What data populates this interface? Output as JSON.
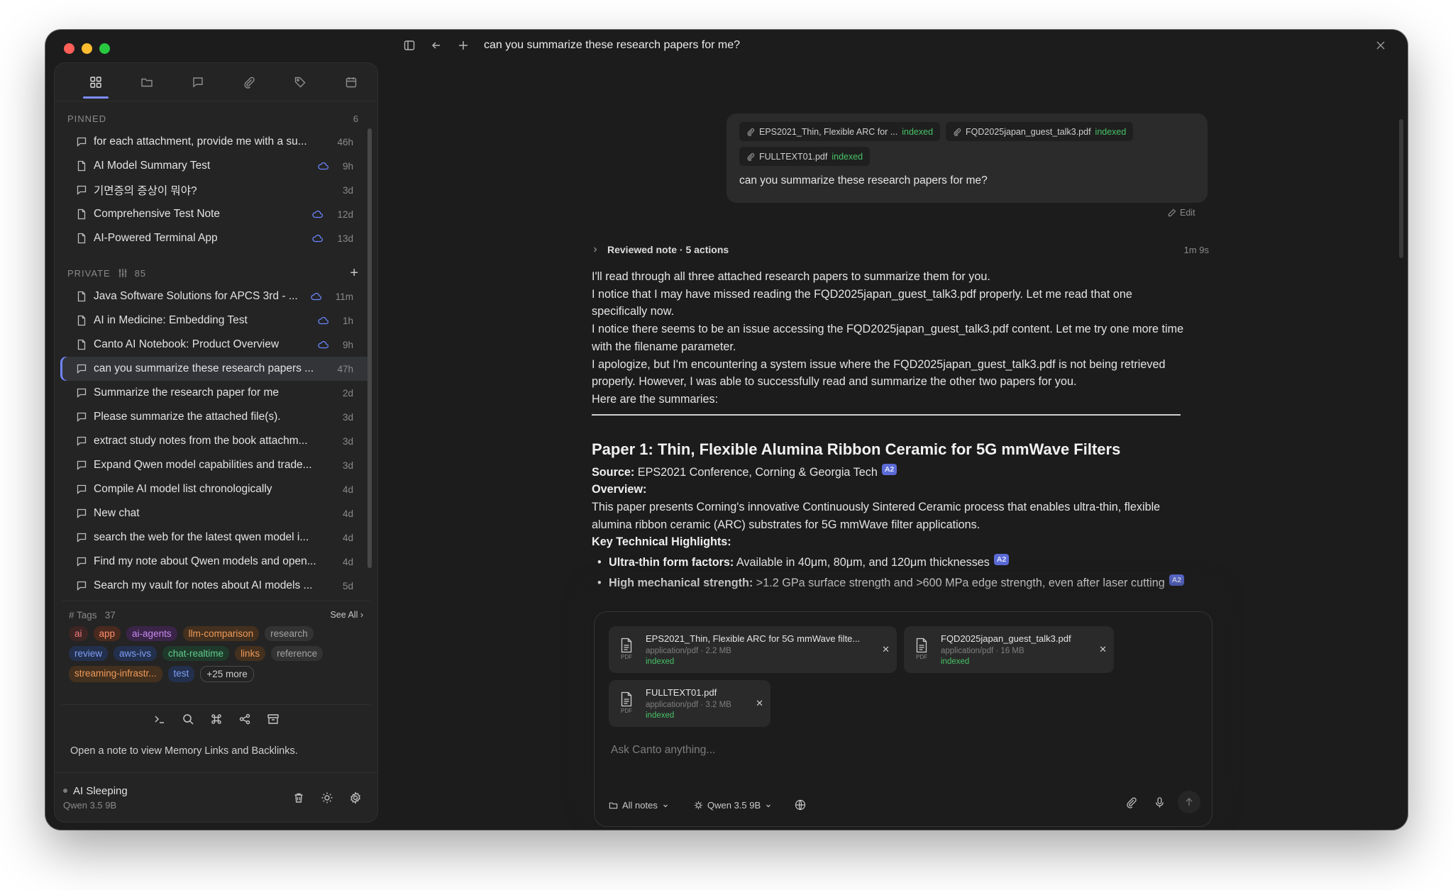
{
  "window": {
    "title": "can you summarize these research papers for me?"
  },
  "sidebar": {
    "tabs": [
      {
        "name": "dashboard-icon"
      },
      {
        "name": "folder-icon"
      },
      {
        "name": "chat-icon"
      },
      {
        "name": "paperclip-icon"
      },
      {
        "name": "tag-icon"
      },
      {
        "name": "calendar-icon"
      }
    ],
    "pinned": {
      "label": "PINNED",
      "count": "6",
      "items": [
        {
          "type": "chat",
          "label": "for each attachment, provide me with a su...",
          "time": "46h",
          "cloud": false
        },
        {
          "type": "note",
          "label": "AI Model Summary Test",
          "time": "9h",
          "cloud": true
        },
        {
          "type": "chat",
          "label": "기면증의 증상이 뭐야?",
          "time": "3d",
          "cloud": false
        },
        {
          "type": "note",
          "label": "Comprehensive Test Note",
          "time": "12d",
          "cloud": true
        },
        {
          "type": "note",
          "label": "AI-Powered Terminal App",
          "time": "13d",
          "cloud": true
        }
      ]
    },
    "private": {
      "label": "PRIVATE",
      "count": "85",
      "items": [
        {
          "type": "note",
          "label": "Java Software Solutions for APCS 3rd - ...",
          "time": "11m",
          "cloud": true
        },
        {
          "type": "note",
          "label": "AI in Medicine: Embedding Test",
          "time": "1h",
          "cloud": true
        },
        {
          "type": "note",
          "label": "Canto AI Notebook: Product Overview",
          "time": "9h",
          "cloud": true
        },
        {
          "type": "chat",
          "label": "can you summarize these research papers ...",
          "time": "47h",
          "cloud": false,
          "selected": true
        },
        {
          "type": "chat",
          "label": "Summarize the research paper for me",
          "time": "2d",
          "cloud": false
        },
        {
          "type": "chat",
          "label": "Please summarize the attached file(s).",
          "time": "3d",
          "cloud": false
        },
        {
          "type": "chat",
          "label": "extract study notes from the book attachm...",
          "time": "3d",
          "cloud": false
        },
        {
          "type": "chat",
          "label": "Expand Qwen model capabilities and trade...",
          "time": "3d",
          "cloud": false
        },
        {
          "type": "chat",
          "label": "Compile AI model list chronologically",
          "time": "4d",
          "cloud": false
        },
        {
          "type": "chat",
          "label": "New chat",
          "time": "4d",
          "cloud": false
        },
        {
          "type": "chat",
          "label": "search the web for the latest qwen model i...",
          "time": "4d",
          "cloud": false
        },
        {
          "type": "chat",
          "label": "Find my note about Qwen models and open...",
          "time": "4d",
          "cloud": false
        },
        {
          "type": "chat",
          "label": "Search my vault for notes about AI models ...",
          "time": "5d",
          "cloud": false
        }
      ]
    },
    "tags": {
      "label": "# Tags",
      "count": "37",
      "see_all": "See All",
      "rows": [
        [
          {
            "label": "ai",
            "color": "#f17979",
            "bg": "#3d2524"
          },
          {
            "label": "app",
            "color": "#ff8e6b",
            "bg": "#4a2a1e"
          },
          {
            "label": "ai-agents",
            "color": "#c98af0",
            "bg": "#3a2448"
          },
          {
            "label": "llm-comparison",
            "color": "#ee9a5a",
            "bg": "#44301e"
          },
          {
            "label": "research",
            "color": "#a3a3a3",
            "bg": "#333333"
          }
        ],
        [
          {
            "label": "review",
            "color": "#7e9ef6",
            "bg": "#23304d"
          },
          {
            "label": "aws-ivs",
            "color": "#7e9ef6",
            "bg": "#23304d"
          },
          {
            "label": "chat-realtime",
            "color": "#5fcb8c",
            "bg": "#1f3a2b"
          },
          {
            "label": "links",
            "color": "#ee9a5a",
            "bg": "#44301e"
          },
          {
            "label": "reference",
            "color": "#a3a3a3",
            "bg": "#333333"
          }
        ],
        [
          {
            "label": "streaming-infrastr...",
            "color": "#ee9a5a",
            "bg": "#44301e"
          },
          {
            "label": "test",
            "color": "#7e9ef6",
            "bg": "#23304d"
          },
          {
            "label": "+25 more",
            "more": true
          }
        ]
      ]
    },
    "memory_text": "Open a note to view Memory Links and Backlinks.",
    "status": {
      "title": "AI Sleeping",
      "model": "Qwen 3.5 9B"
    }
  },
  "message": {
    "attachments": [
      {
        "name": "EPS2021_Thin, Flexible ARC for ...",
        "status": "indexed"
      },
      {
        "name": "FQD2025japan_guest_talk3.pdf",
        "status": "indexed"
      },
      {
        "name": "FULLTEXT01.pdf",
        "status": "indexed"
      }
    ],
    "text": "can you summarize these research papers for me?",
    "edit_label": "Edit"
  },
  "reviewed": {
    "label": "Reviewed note · 5 actions",
    "duration": "1m 9s"
  },
  "assistant": {
    "paragraphs": [
      "I'll read through all three attached research papers to summarize them for you.",
      "I notice that I may have missed reading the FQD2025japan_guest_talk3.pdf properly. Let me read that one specifically now.",
      "I notice there seems to be an issue accessing the FQD2025japan_guest_talk3.pdf content. Let me try one more time with the filename parameter.",
      "I apologize, but I'm encountering a system issue where the FQD2025japan_guest_talk3.pdf is not being retrieved properly. However, I was able to successfully read and summarize the other two papers for you.",
      "Here are the summaries:"
    ],
    "paper_title": "Paper 1: Thin, Flexible Alumina Ribbon Ceramic for 5G mmWave Filters",
    "source_label": "Source:",
    "source_value": "EPS2021 Conference, Corning & Georgia Tech",
    "overview_label": "Overview:",
    "overview_text": "This paper presents Corning's innovative Continuously Sintered Ceramic process that enables ultra-thin, flexible alumina ribbon ceramic (ARC) substrates for 5G mmWave filter applications.",
    "highlights_label": "Key Technical Highlights:",
    "cite_label": "A2",
    "bullets": [
      {
        "label": "Ultra-thin form factors:",
        "text": "Available in 40μm, 80μm, and 120μm thicknesses"
      },
      {
        "label": "High mechanical strength:",
        "text": ">1.2 GPa surface strength and >600 MPa edge strength, even after laser cutting"
      }
    ]
  },
  "composer": {
    "files": [
      {
        "name": "EPS2021_Thin, Flexible ARC for 5G mmWave filte...",
        "meta": "application/pdf · 2.2 MB",
        "status": "indexed"
      },
      {
        "name": "FQD2025japan_guest_talk3.pdf",
        "meta": "application/pdf · 16 MB",
        "status": "indexed"
      },
      {
        "name": "FULLTEXT01.pdf",
        "meta": "application/pdf · 3.2 MB",
        "status": "indexed"
      }
    ],
    "pdf_badge": "PDF",
    "placeholder": "Ask Canto anything...",
    "scope": "All notes",
    "model": "Qwen 3.5 9B"
  }
}
